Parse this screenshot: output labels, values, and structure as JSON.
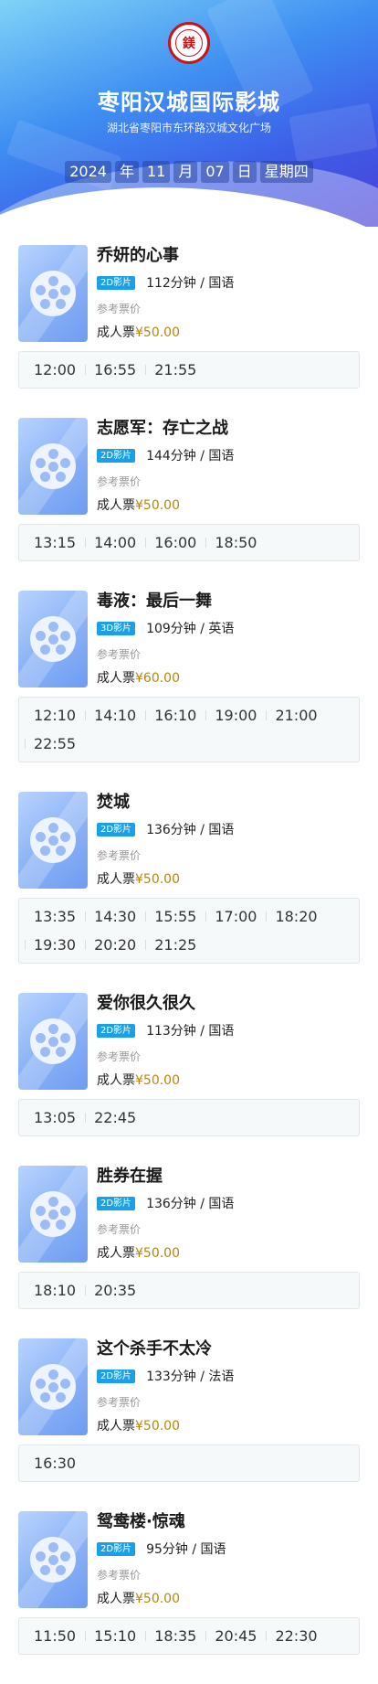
{
  "header": {
    "logo_text": "鎂",
    "cinema_name": "枣阳汉城国际影城",
    "address": "湖北省枣阳市东环路汉城文化广场",
    "date": {
      "year": "2024",
      "year_unit": "年",
      "month": "11",
      "month_unit": "月",
      "day": "07",
      "day_unit": "日",
      "weekday": "星期四"
    }
  },
  "labels": {
    "ref_price": "参考票价",
    "adult_ticket": "成人票"
  },
  "movies": [
    {
      "title": "乔妍的心事",
      "format": "2D影片",
      "duration_lang": "112分钟 / 国语",
      "price": "¥50.00",
      "times": [
        "12:00",
        "16:55",
        "21:55"
      ]
    },
    {
      "title": "志愿军：存亡之战",
      "format": "2D影片",
      "duration_lang": "144分钟 / 国语",
      "price": "¥50.00",
      "times": [
        "13:15",
        "14:00",
        "16:00",
        "18:50"
      ]
    },
    {
      "title": "毒液：最后一舞",
      "format": "3D影片",
      "duration_lang": "109分钟 / 英语",
      "price": "¥60.00",
      "times": [
        "12:10",
        "14:10",
        "16:10",
        "19:00",
        "21:00",
        "22:55"
      ]
    },
    {
      "title": "焚城",
      "format": "2D影片",
      "duration_lang": "136分钟 / 国语",
      "price": "¥50.00",
      "times": [
        "13:35",
        "14:30",
        "15:55",
        "17:00",
        "18:20",
        "19:30",
        "20:20",
        "21:25"
      ]
    },
    {
      "title": "爱你很久很久",
      "format": "2D影片",
      "duration_lang": "113分钟 / 国语",
      "price": "¥50.00",
      "times": [
        "13:05",
        "22:45"
      ]
    },
    {
      "title": "胜券在握",
      "format": "2D影片",
      "duration_lang": "136分钟 / 国语",
      "price": "¥50.00",
      "times": [
        "18:10",
        "20:35"
      ]
    },
    {
      "title": "这个杀手不太冷",
      "format": "2D影片",
      "duration_lang": "133分钟 / 法语",
      "price": "¥50.00",
      "times": [
        "16:30"
      ]
    },
    {
      "title": "鸳鸯楼·惊魂",
      "format": "2D影片",
      "duration_lang": "95分钟 / 国语",
      "price": "¥50.00",
      "times": [
        "11:50",
        "15:10",
        "18:35",
        "20:45",
        "22:30"
      ]
    }
  ]
}
